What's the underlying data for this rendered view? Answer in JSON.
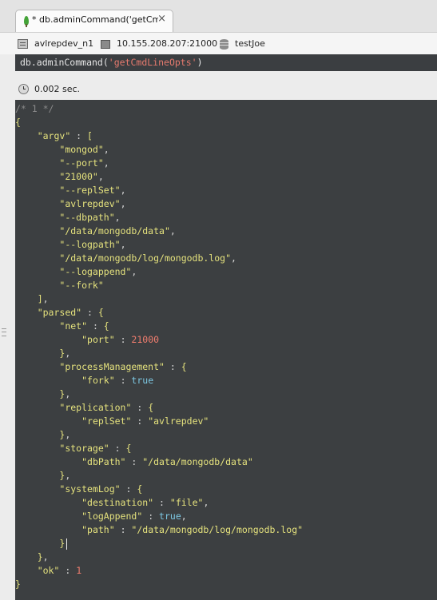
{
  "tab": {
    "title": "* db.adminCommand('getCmdLi...",
    "close": "×"
  },
  "info": {
    "server": "avlrepdev_n1",
    "host": "10.155.208.207:21000",
    "database": "testJoe",
    "icons": [
      "server-icon",
      "monitor-icon",
      "database-icon"
    ]
  },
  "query": {
    "function": "db.adminCommand(",
    "argument": "'getCmdLineOpts'",
    "close": ")"
  },
  "result": {
    "time": "0.002 sec.",
    "comment": "/* 1 */",
    "argv_key": "\"argv\"",
    "argv": [
      "\"mongod\"",
      "\"--port\"",
      "\"21000\"",
      "\"--replSet\"",
      "\"avlrepdev\"",
      "\"--dbpath\"",
      "\"/data/mongodb/data\"",
      "\"--logpath\"",
      "\"/data/mongodb/log/mongodb.log\"",
      "\"--logappend\"",
      "\"--fork\""
    ],
    "parsed_key": "\"parsed\"",
    "net_key": "\"net\"",
    "port_key": "\"port\"",
    "port_val": "21000",
    "pm_key": "\"processManagement\"",
    "fork_key": "\"fork\"",
    "fork_val": "true",
    "repl_key": "\"replication\"",
    "replset_key": "\"replSet\"",
    "replset_val": "\"avlrepdev\"",
    "storage_key": "\"storage\"",
    "dbpath_key": "\"dbPath\"",
    "dbpath_val": "\"/data/mongodb/data\"",
    "syslog_key": "\"systemLog\"",
    "dest_key": "\"destination\"",
    "dest_val": "\"file\"",
    "logappend_key": "\"logAppend\"",
    "logappend_val": "true",
    "path_key": "\"path\"",
    "path_val": "\"/data/mongodb/log/mongodb.log\"",
    "ok_key": "\"ok\"",
    "ok_val": "1"
  },
  "colors": {
    "editor_bg": "#3c3f41",
    "string": "#e5e27d",
    "number": "#f07d6e",
    "boolean": "#7dc8e3"
  }
}
